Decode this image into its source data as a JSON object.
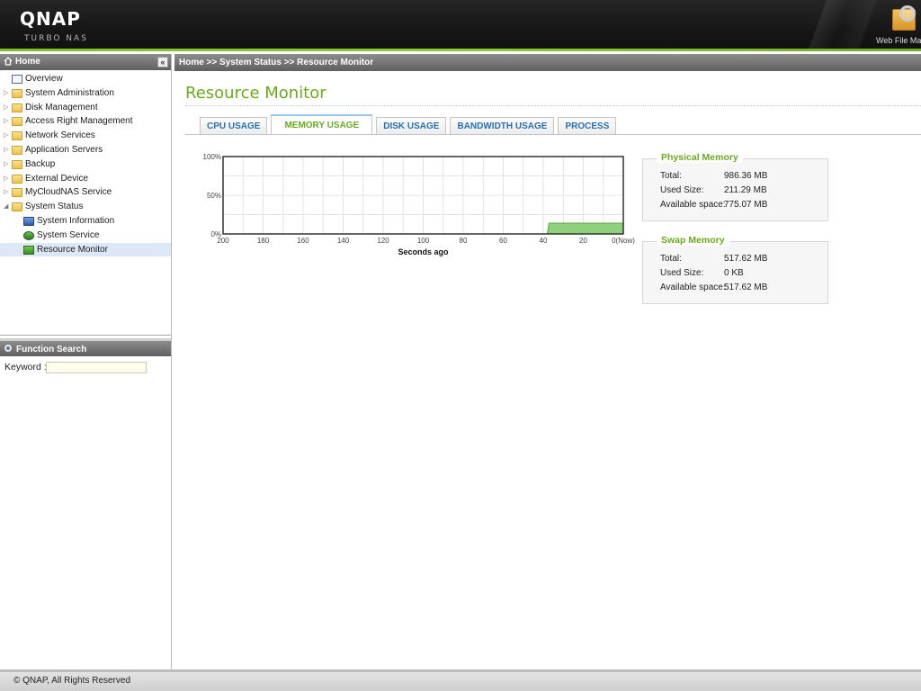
{
  "header": {
    "brand": "QNAP",
    "product": "TURBO NAS",
    "webfile_label": "Web File Ma"
  },
  "sidebar": {
    "home_title": "Home",
    "collapse_label": "«",
    "items": [
      {
        "label": "Overview",
        "icon": "overview-icon",
        "level": 0
      },
      {
        "label": "System Administration",
        "icon": "folder-icon",
        "level": 0
      },
      {
        "label": "Disk Management",
        "icon": "folder-icon",
        "level": 0
      },
      {
        "label": "Access Right Management",
        "icon": "folder-icon",
        "level": 0
      },
      {
        "label": "Network Services",
        "icon": "folder-icon",
        "level": 0
      },
      {
        "label": "Application Servers",
        "icon": "folder-icon",
        "level": 0
      },
      {
        "label": "Backup",
        "icon": "folder-icon",
        "level": 0
      },
      {
        "label": "External Device",
        "icon": "folder-icon",
        "level": 0
      },
      {
        "label": "MyCloudNAS Service",
        "icon": "folder-icon",
        "level": 0
      },
      {
        "label": "System Status",
        "icon": "folder-open-icon",
        "level": 0
      },
      {
        "label": "System Information",
        "icon": "system-info-icon",
        "level": 1
      },
      {
        "label": "System Service",
        "icon": "system-service-icon",
        "level": 1
      },
      {
        "label": "Resource Monitor",
        "icon": "resource-monitor-icon",
        "level": 1
      }
    ],
    "function_search_title": "Function Search",
    "keyword_label": "Keyword :",
    "keyword_value": ""
  },
  "breadcrumb": "Home >> System Status >> Resource Monitor",
  "main": {
    "title": "Resource Monitor",
    "tabs": [
      {
        "label": "CPU USAGE",
        "active": false
      },
      {
        "label": "MEMORY USAGE",
        "active": true
      },
      {
        "label": "DISK USAGE",
        "active": false
      },
      {
        "label": "BANDWIDTH USAGE",
        "active": false
      },
      {
        "label": "PROCESS",
        "active": false
      }
    ]
  },
  "chart_data": {
    "type": "area",
    "xlabel": "Seconds ago",
    "ylabel": "",
    "x_ticks": [
      "200",
      "180",
      "160",
      "140",
      "120",
      "100",
      "80",
      "60",
      "40",
      "20",
      "0(Now)"
    ],
    "y_ticks": [
      "0%",
      "50%",
      "100%"
    ],
    "xlim": [
      200,
      0
    ],
    "ylim": [
      0,
      100
    ],
    "series": [
      {
        "values_x": [
          38,
          0
        ],
        "values_y": [
          14,
          14
        ],
        "color": "#8fd07a"
      }
    ],
    "grid": true
  },
  "physical_memory": {
    "title": "Physical Memory",
    "rows": [
      {
        "label": "Total:",
        "value": "986.36 MB"
      },
      {
        "label": "Used Size:",
        "value": "211.29 MB"
      },
      {
        "label": "Available space:",
        "value": "775.07 MB"
      }
    ]
  },
  "swap_memory": {
    "title": "Swap Memory",
    "rows": [
      {
        "label": "Total:",
        "value": "517.62 MB"
      },
      {
        "label": "Used Size:",
        "value": "0 KB"
      },
      {
        "label": "Available space:",
        "value": "517.62 MB"
      }
    ]
  },
  "footer": "© QNAP, All Rights Reserved",
  "colors": {
    "accent_green": "#6aaa1e",
    "link_blue": "#2a6fb5",
    "header_bg": "#1a1a1a"
  }
}
